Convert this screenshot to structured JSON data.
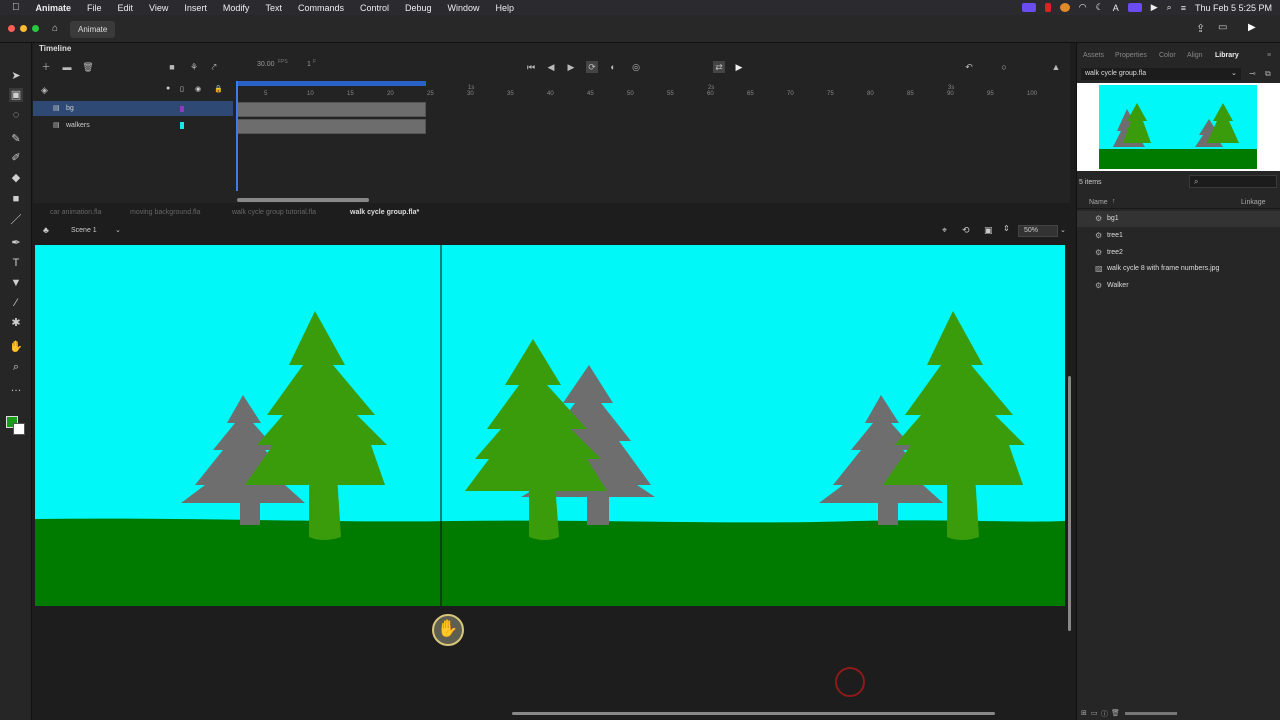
{
  "menubar": {
    "apple": "",
    "items": [
      "Animate",
      "File",
      "Edit",
      "View",
      "Insert",
      "Modify",
      "Text",
      "Commands",
      "Control",
      "Debug",
      "Window",
      "Help"
    ],
    "clock": "Thu Feb 5  5:25 PM"
  },
  "titlebar": {
    "tab": "Animate"
  },
  "timeline": {
    "title": "Timeline",
    "fps": "30.00",
    "fps_unit": "FPS",
    "frame": "1",
    "frame_unit": "F",
    "ruler": [
      "5",
      "10",
      "15",
      "20",
      "25",
      "30",
      "35",
      "40",
      "45",
      "50",
      "55",
      "60",
      "65",
      "70",
      "75",
      "80",
      "85",
      "90",
      "95",
      "100"
    ],
    "ruler_secs": [
      "1s",
      "2s",
      "3s"
    ],
    "layers": [
      {
        "name": "bg",
        "selected": true,
        "color": "#8b3cc4"
      },
      {
        "name": "walkers",
        "selected": false,
        "color": "#1ee6e6"
      }
    ]
  },
  "doc_tabs": [
    {
      "label": "car animation.fla",
      "active": false
    },
    {
      "label": "moving background.fla",
      "active": false
    },
    {
      "label": "walk cycle group tutorial.fla",
      "active": false
    },
    {
      "label": "walk cycle group.fla*",
      "active": true
    }
  ],
  "stage": {
    "scene": "Scene 1",
    "zoom": "50%",
    "sky_color": "#00f8f8",
    "ground_color": "#007b00",
    "tree_green": "#3a9c0a",
    "tree_gray": "#6e6e6e"
  },
  "library": {
    "tabs": [
      "Assets",
      "Properties",
      "Color",
      "Align",
      "Library"
    ],
    "active_tab": "Library",
    "document": "walk cycle group.fla",
    "count": "5 items",
    "col_name": "Name",
    "col_linkage": "Linkage",
    "items": [
      {
        "name": "bg1",
        "icon": "movieclip-icon",
        "selected": true
      },
      {
        "name": "tree1",
        "icon": "movieclip-icon",
        "selected": false
      },
      {
        "name": "tree2",
        "icon": "movieclip-icon",
        "selected": false
      },
      {
        "name": "walk cycle 8 with frame numbers.jpg",
        "icon": "bitmap-icon",
        "selected": false
      },
      {
        "name": "Walker",
        "icon": "movieclip-icon",
        "selected": false
      }
    ]
  }
}
